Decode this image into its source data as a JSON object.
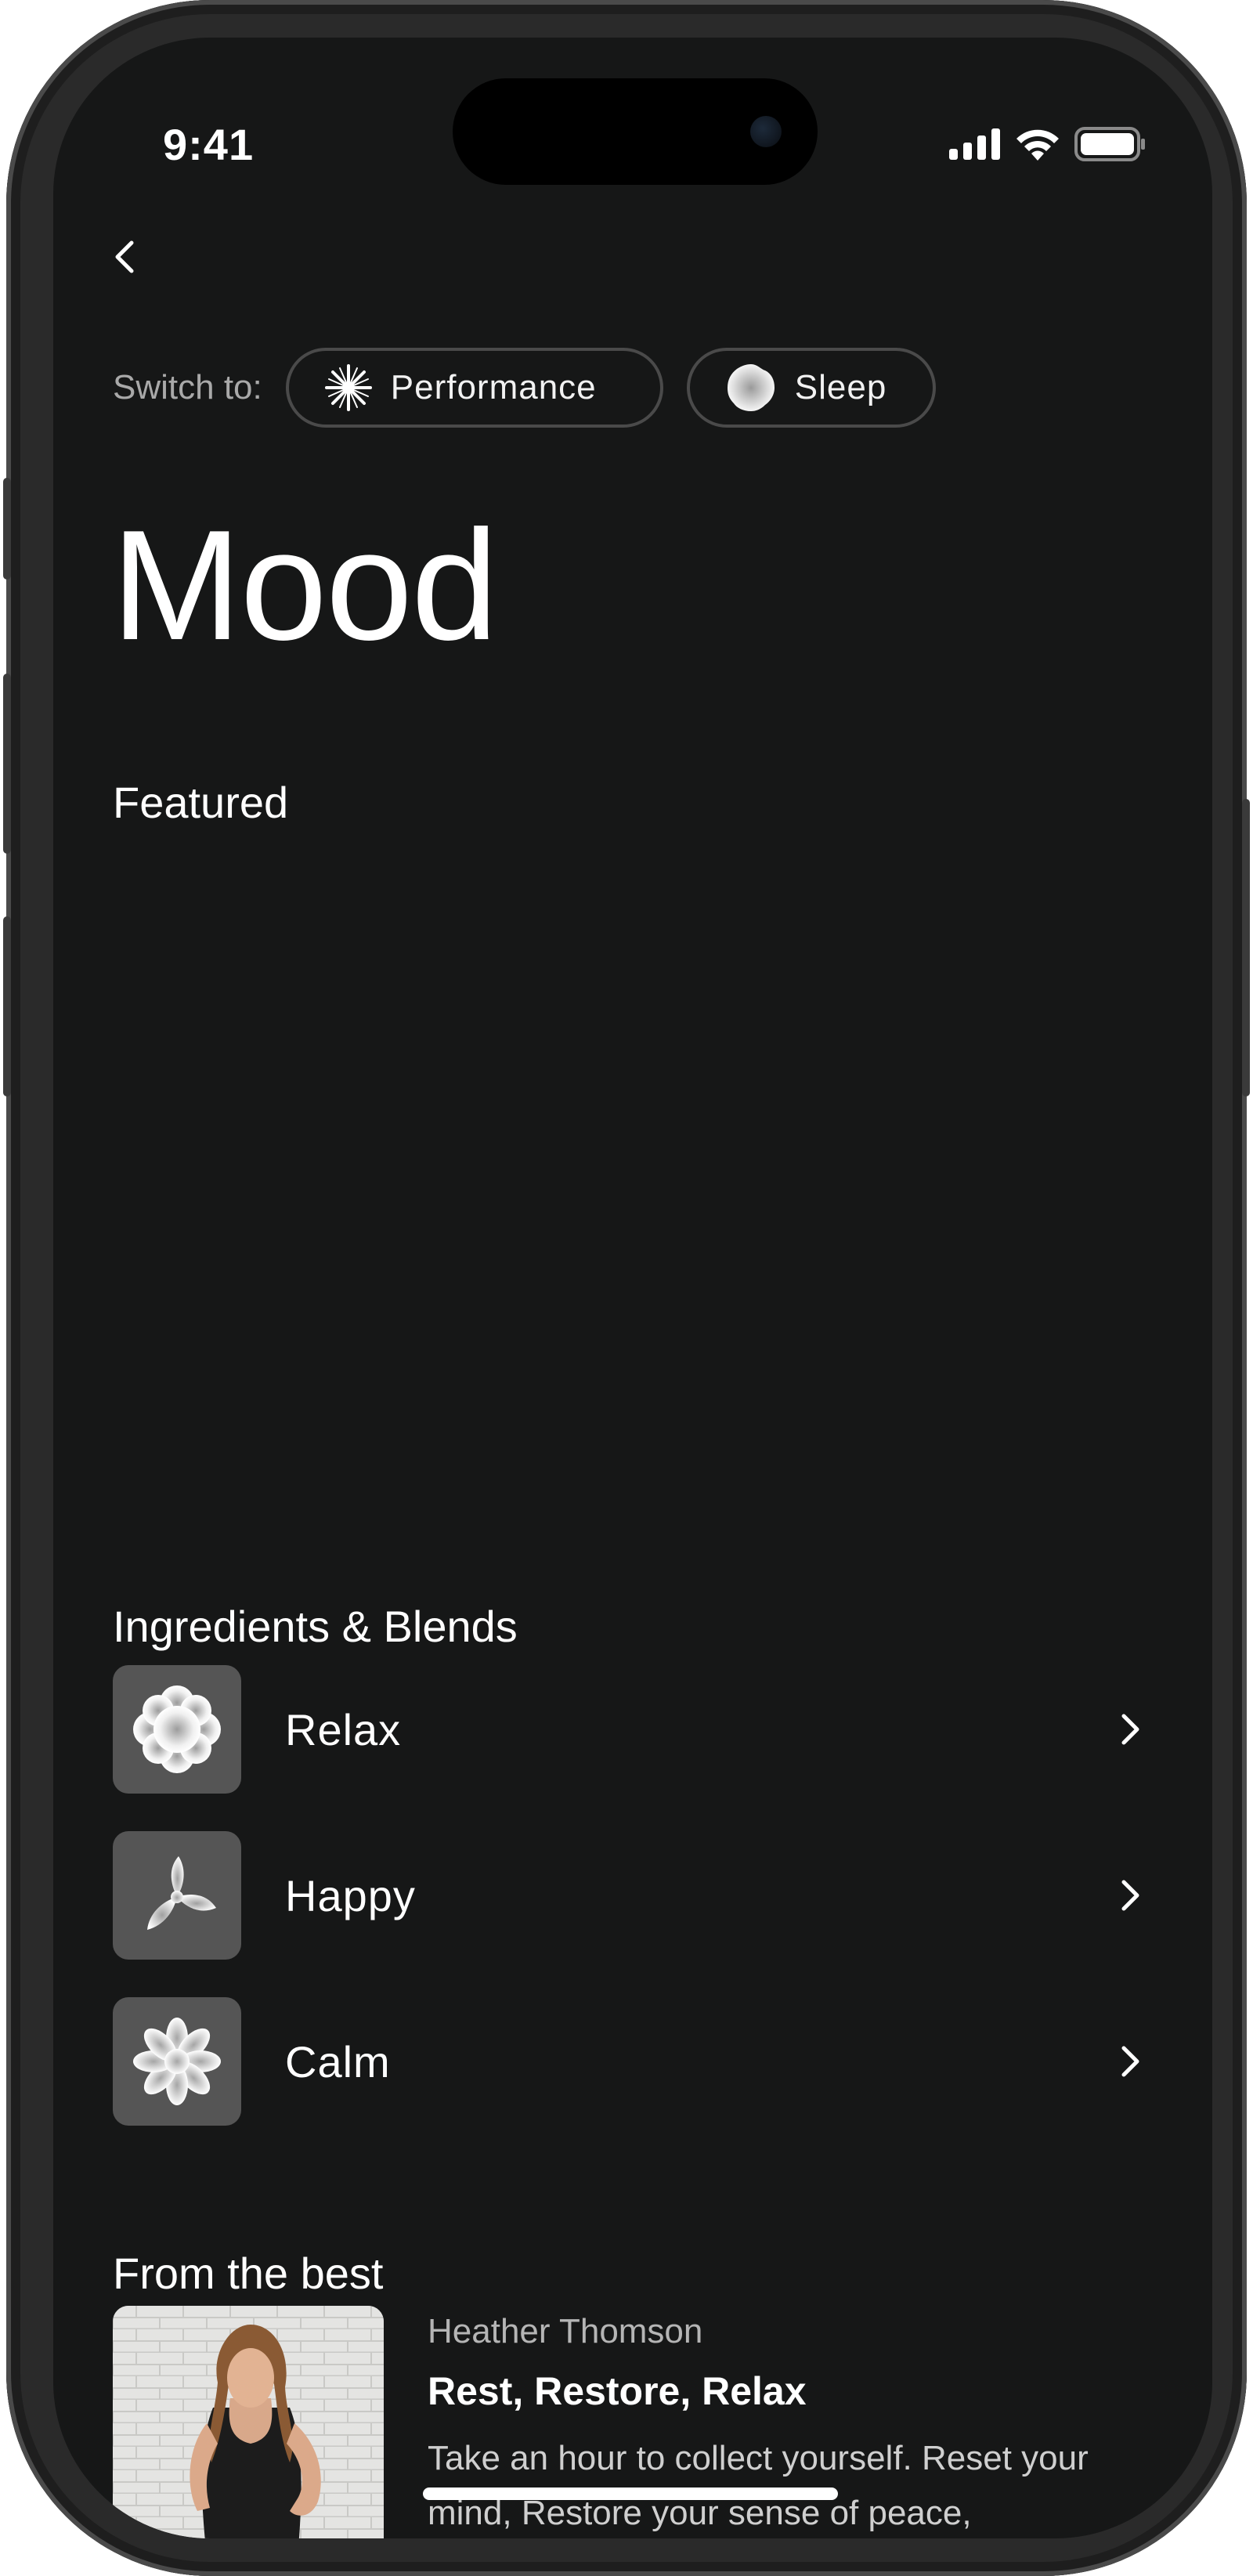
{
  "status_bar": {
    "time": "9:41"
  },
  "nav": {
    "back_icon": "chevron-left-icon"
  },
  "switcher": {
    "label": "Switch to:",
    "options": [
      {
        "label": "Performance",
        "icon": "starburst-icon"
      },
      {
        "label": "Sleep",
        "icon": "blob-icon"
      }
    ]
  },
  "page": {
    "title": "Mood"
  },
  "featured": {
    "heading": "Featured"
  },
  "ingredients": {
    "heading": "Ingredients & Blends",
    "items": [
      {
        "label": "Relax",
        "icon": "flower-icon"
      },
      {
        "label": "Happy",
        "icon": "petals-icon"
      },
      {
        "label": "Calm",
        "icon": "daisy-icon"
      }
    ]
  },
  "from_the_best": {
    "heading": "From the best",
    "card": {
      "author": "Heather Thomson",
      "title": "Rest, Restore, Relax",
      "description": "Take an hour to collect yourself. Reset your mind, Restore your sense of peace,"
    }
  },
  "colors": {
    "background": "#161717",
    "pill_border": "#4a4a4a",
    "thumb": "#555555"
  }
}
